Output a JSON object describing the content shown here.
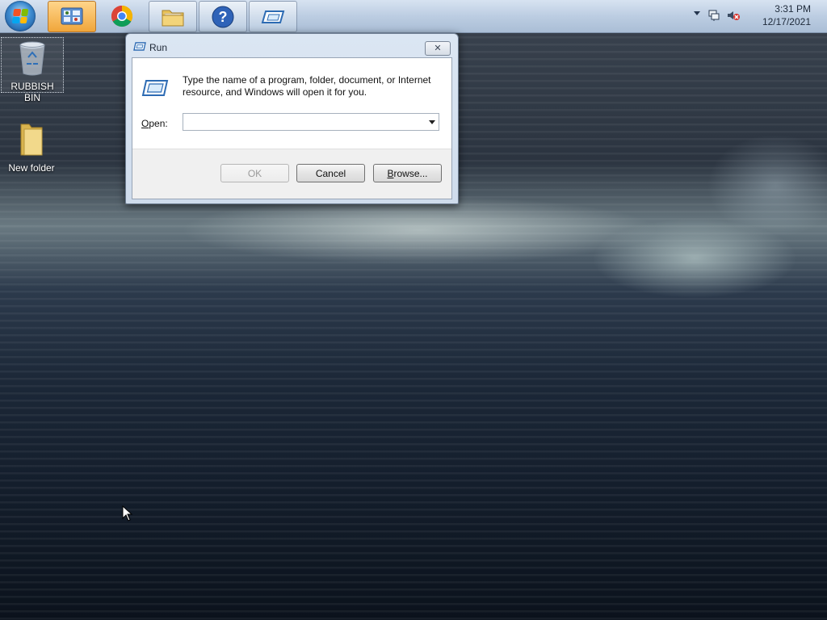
{
  "taskbar": {
    "start_button": {
      "icon": "windows-start-orb-icon"
    },
    "buttons": [
      {
        "name": "control-panel",
        "icon": "control-panel-icon",
        "active": true
      },
      {
        "name": "chrome",
        "icon": "chrome-icon",
        "active": false
      },
      {
        "name": "windows-explorer",
        "icon": "folder-explorer-icon",
        "active": false
      },
      {
        "name": "help",
        "icon": "help-icon",
        "active": false
      },
      {
        "name": "run",
        "icon": "run-icon",
        "active": false
      }
    ],
    "tray": {
      "time": "3:31 PM",
      "date": "12/17/2021",
      "icons": [
        "show-hidden-icons-arrow",
        "network-icon",
        "volume-muted-icon"
      ]
    }
  },
  "desktop": {
    "icons": [
      {
        "label": "RUBBISH BIN",
        "icon": "recycle-bin-icon",
        "selected": true
      },
      {
        "label": "New folder",
        "icon": "folder-icon",
        "selected": false
      }
    ]
  },
  "run_dialog": {
    "title": "Run",
    "description": "Type the name of a program, folder, document, or Internet resource, and Windows will open it for you.",
    "open_label_mnemonic": "O",
    "open_label_rest": "pen:",
    "open_value": "",
    "ok_label": "OK",
    "cancel_label": "Cancel",
    "browse_mnemonic": "B",
    "browse_rest": "rowse...",
    "close_glyph": "✕"
  },
  "colors": {
    "taskbar": "#bccde2",
    "dialog_frame": "#cfdcec",
    "active_button": "#f0a63b"
  }
}
